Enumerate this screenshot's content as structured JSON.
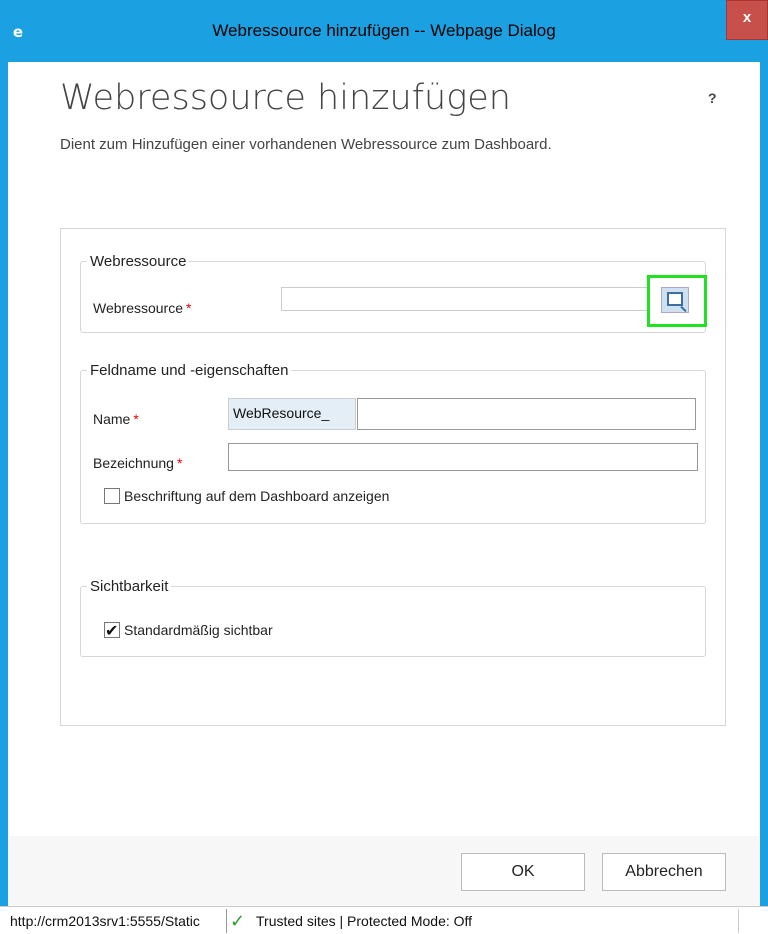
{
  "window": {
    "title": "Webressource hinzufügen -- Webpage Dialog",
    "close_label": "x",
    "ie_icon": "e"
  },
  "dialog": {
    "heading": "Webressource hinzufügen",
    "help": "?",
    "subtitle": "Dient zum Hinzufügen einer vorhandenen Webressource zum Dashboard."
  },
  "webresource_group": {
    "legend": "Webressource",
    "field_label": "Webressource",
    "required_mark": "*",
    "value": "",
    "lookup_icon": "lookup-icon"
  },
  "field_group": {
    "legend": "Feldname und -eigenschaften",
    "name_label": "Name",
    "name_prefix": "WebResource_",
    "name_value": "",
    "label_label": "Bezeichnung",
    "label_value": "",
    "required_mark": "*",
    "show_label_text": "Beschriftung auf dem Dashboard anzeigen",
    "show_label_checked": false
  },
  "visibility_group": {
    "legend": "Sichtbarkeit",
    "default_visible_text": "Standardmäßig sichtbar",
    "default_visible_checked": true
  },
  "buttons": {
    "ok": "OK",
    "cancel": "Abbrechen"
  },
  "statusbar": {
    "url": "http://crm2013srv1:5555/Static",
    "zone": "Trusted sites | Protected Mode: Off",
    "zone_icon": "check-icon"
  },
  "colors": {
    "frame": "#1ba1e2",
    "close_button": "#c7504a",
    "highlight": "#22e022",
    "required": "#e00000"
  }
}
